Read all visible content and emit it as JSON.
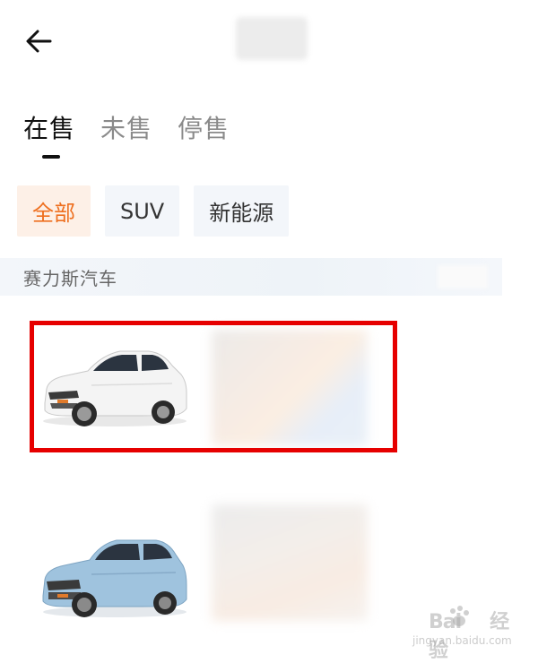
{
  "header": {
    "back_icon": "arrow-left-icon"
  },
  "tabs": [
    {
      "label": "在售",
      "active": true
    },
    {
      "label": "未售",
      "active": false
    },
    {
      "label": "停售",
      "active": false
    }
  ],
  "filters": [
    {
      "label": "全部",
      "active": true
    },
    {
      "label": "SUV",
      "active": false
    },
    {
      "label": "新能源",
      "active": false
    }
  ],
  "brand": {
    "label": "赛力斯汽车"
  },
  "cars": [
    {
      "color": "#f4f4f4",
      "highlighted": true
    },
    {
      "color": "#9fc3de",
      "highlighted": false
    }
  ],
  "colors": {
    "accent": "#ee6f1f",
    "accent_bg": "#fdf0e7",
    "chip_bg": "#f3f6fa",
    "highlight": "#e60000"
  },
  "watermark": {
    "brand": "Bai",
    "brand_suffix": "经验",
    "url": "jingyan.baidu.com"
  }
}
